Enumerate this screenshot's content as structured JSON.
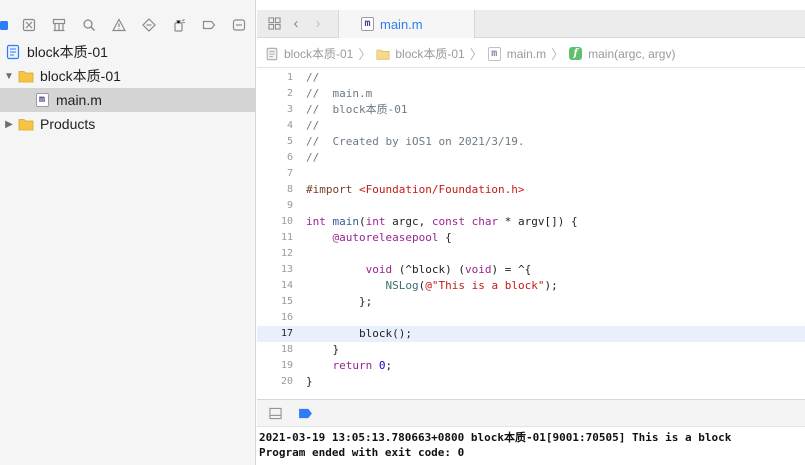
{
  "navigator": {
    "tree": [
      {
        "label": "block本质-01",
        "kind": "project"
      },
      {
        "label": "block本质-01",
        "kind": "folder",
        "expanded": true
      },
      {
        "label": "main.m",
        "kind": "file",
        "selected": true
      },
      {
        "label": "Products",
        "kind": "folder",
        "expanded": false
      }
    ]
  },
  "editor": {
    "tab": {
      "label": "main.m"
    },
    "breadcrumb": [
      "block本质-01",
      "block本质-01",
      "main.m",
      "main(argc, argv)"
    ],
    "current_line": 17,
    "lines": [
      {
        "n": "1",
        "tokens": [
          {
            "t": "//",
            "c": "comment"
          }
        ]
      },
      {
        "n": "2",
        "tokens": [
          {
            "t": "//  main.m",
            "c": "comment"
          }
        ]
      },
      {
        "n": "3",
        "tokens": [
          {
            "t": "//  block本质-01",
            "c": "comment"
          }
        ]
      },
      {
        "n": "4",
        "tokens": [
          {
            "t": "//",
            "c": "comment"
          }
        ]
      },
      {
        "n": "5",
        "tokens": [
          {
            "t": "//  Created by iOS1 on 2021/3/19.",
            "c": "comment"
          }
        ]
      },
      {
        "n": "6",
        "tokens": [
          {
            "t": "//",
            "c": "comment"
          }
        ]
      },
      {
        "n": "7",
        "tokens": []
      },
      {
        "n": "8",
        "tokens": [
          {
            "t": "#import ",
            "c": "prep"
          },
          {
            "t": "<Foundation/Foundation.h>",
            "c": "string"
          }
        ]
      },
      {
        "n": "9",
        "tokens": []
      },
      {
        "n": "10",
        "tokens": [
          {
            "t": "int",
            "c": "kw"
          },
          {
            "t": " "
          },
          {
            "t": "main",
            "c": "fn"
          },
          {
            "t": "("
          },
          {
            "t": "int",
            "c": "kw"
          },
          {
            "t": " argc, "
          },
          {
            "t": "const",
            "c": "kw"
          },
          {
            "t": " "
          },
          {
            "t": "char",
            "c": "kw"
          },
          {
            "t": " * argv[]) {"
          }
        ]
      },
      {
        "n": "11",
        "tokens": [
          {
            "t": "    "
          },
          {
            "t": "@autoreleasepool",
            "c": "kw"
          },
          {
            "t": " {"
          }
        ]
      },
      {
        "n": "12",
        "tokens": []
      },
      {
        "n": "13",
        "tokens": [
          {
            "t": "         "
          },
          {
            "t": "void",
            "c": "kw"
          },
          {
            "t": " (^block) ("
          },
          {
            "t": "void",
            "c": "kw"
          },
          {
            "t": ") = ^{"
          }
        ]
      },
      {
        "n": "14",
        "tokens": [
          {
            "t": "            "
          },
          {
            "t": "NSLog",
            "c": "call"
          },
          {
            "t": "("
          },
          {
            "t": "@\"This is a block\"",
            "c": "string"
          },
          {
            "t": ");"
          }
        ]
      },
      {
        "n": "15",
        "tokens": [
          {
            "t": "        };"
          }
        ]
      },
      {
        "n": "16",
        "tokens": []
      },
      {
        "n": "17",
        "tokens": [
          {
            "t": "        block();"
          }
        ]
      },
      {
        "n": "18",
        "tokens": [
          {
            "t": "    }"
          }
        ]
      },
      {
        "n": "19",
        "tokens": [
          {
            "t": "    "
          },
          {
            "t": "return",
            "c": "kw"
          },
          {
            "t": " "
          },
          {
            "t": "0",
            "c": "num"
          },
          {
            "t": ";"
          }
        ]
      },
      {
        "n": "20",
        "tokens": [
          {
            "t": "}"
          }
        ]
      }
    ]
  },
  "console": {
    "lines": [
      "2021-03-19 13:05:13.780663+0800 block本质-01[9001:70505] This is a block",
      "Program ended with exit code: 0"
    ]
  },
  "colors": {
    "accent": "#2f7cf6",
    "keyword": "#9b2393",
    "string": "#c41a16",
    "comment": "#6c7a86",
    "current_line": "#e8f0fc"
  }
}
